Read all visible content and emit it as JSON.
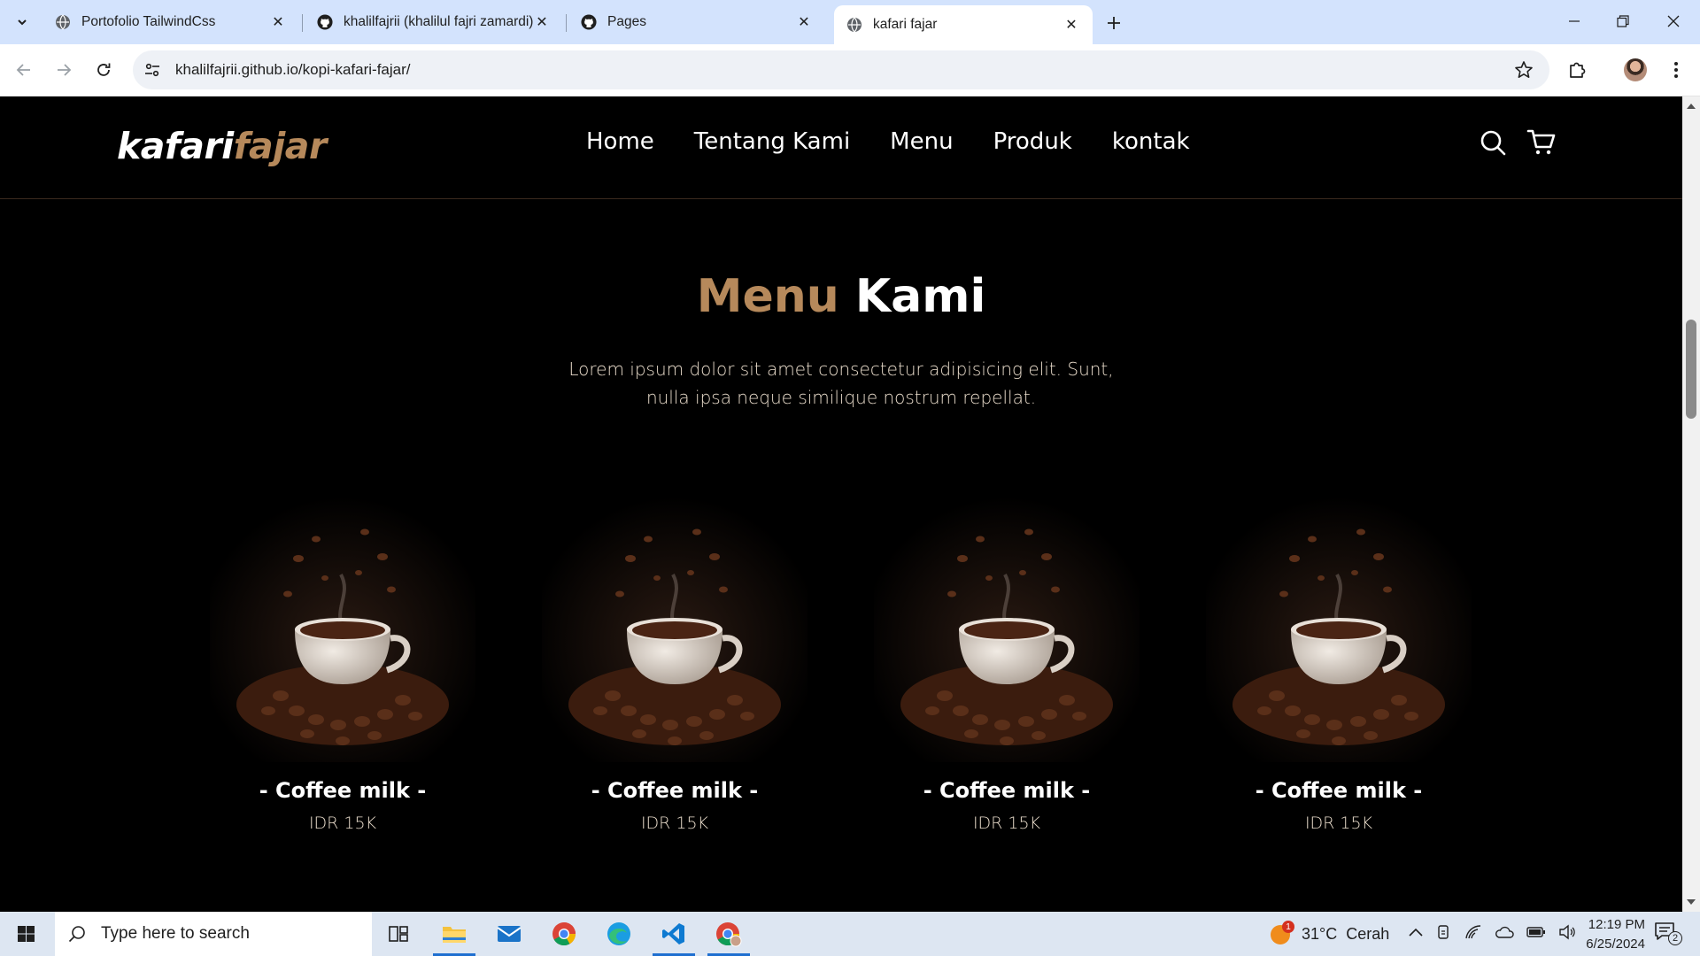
{
  "browser": {
    "tabs": [
      {
        "title": "Portofolio TailwindCss",
        "favicon": "globe-icon",
        "active": false
      },
      {
        "title": "khalilfajrii (khalilul fajri zamardi)",
        "favicon": "github-icon",
        "active": false
      },
      {
        "title": "Pages",
        "favicon": "github-icon",
        "active": false
      },
      {
        "title": "kafari fajar",
        "favicon": "globe-icon",
        "active": true
      }
    ],
    "url": "khalilfajrii.github.io/kopi-kafari-fajar/"
  },
  "site": {
    "logo_part1": "kafari",
    "logo_part2": "fajar",
    "nav": [
      "Home",
      "Tentang Kami",
      "Menu",
      "Produk",
      "kontak"
    ],
    "colors": {
      "accent": "#b6895b",
      "background": "#000000",
      "text_muted": "#e9dccb"
    }
  },
  "menu_section": {
    "title_accent": "Menu",
    "title_rest": "Kami",
    "description_line1": "Lorem ipsum dolor sit amet consectetur adipisicing elit. Sunt,",
    "description_line2": "nulla ipsa neque similique nostrum repellat.",
    "items": [
      {
        "name": "- Coffee milk -",
        "price": "IDR 15K"
      },
      {
        "name": "- Coffee milk -",
        "price": "IDR 15K"
      },
      {
        "name": "- Coffee milk -",
        "price": "IDR 15K"
      },
      {
        "name": "- Coffee milk -",
        "price": "IDR 15K"
      }
    ]
  },
  "taskbar": {
    "search_placeholder": "Type here to search",
    "weather": "31°C  Cerah",
    "weather_badge": "1",
    "time": "12:19 PM",
    "date": "6/25/2024",
    "notification_count": "2"
  }
}
